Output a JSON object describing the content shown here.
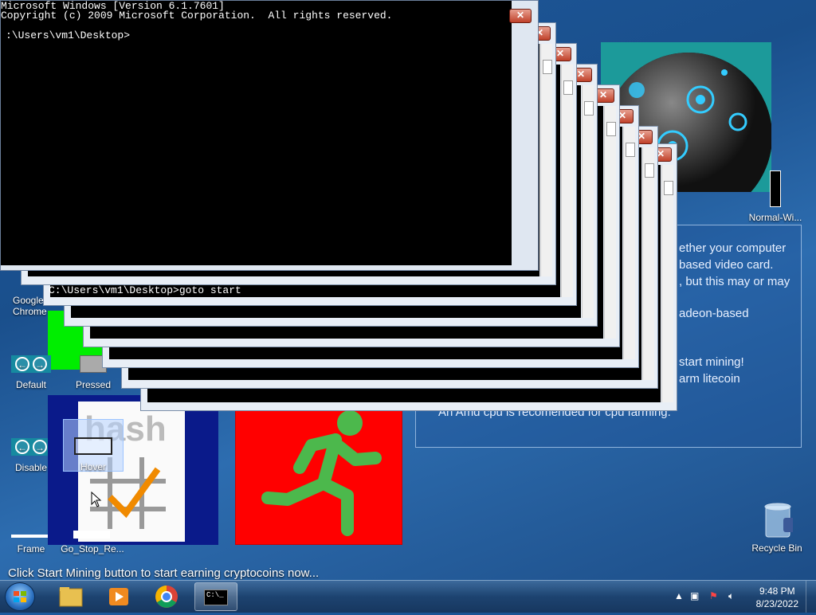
{
  "terminal": {
    "header_line1": "Microsoft Windows [Version 6.1.7601]",
    "header_line2": "Copyright (c) 2009 Microsoft Corporation.  All rights reserved.",
    "prompt": ":\\Users\\vm1\\Desktop>",
    "command_line": "C:\\Users\\vm1\\Desktop>goto start",
    "close_glyph": "✕"
  },
  "desktop_icons": {
    "google_chrome": "Google Chrome",
    "default": "Default",
    "pressed": "Pressed",
    "disable": "Disable",
    "hover": "Hover",
    "frame": "Frame",
    "go_stop": "Go_Stop_Re...",
    "normal_wi": "Normal-Wi...",
    "recycle_bin": "Recycle Bin"
  },
  "info_panel": {
    "line1": "ether your computer",
    "line2": "based video card.",
    "line3": ", but this may or may",
    "line4": "adeon-based",
    "line5": "start mining!",
    "line6": "arm litecoin",
    "line7": "An Amd cpu is recomended for cpu farming."
  },
  "hash_icon_text": "hash",
  "status_text": "Click Start Mining button to start earning cryptocoins now...",
  "taskbar": {
    "time": "9:48 PM",
    "date": "8/23/2022",
    "cmd_icon_label": "C:\\_"
  },
  "colors": {
    "desktop_blue": "#1e5a9e",
    "go_stop_red": "#ff0000",
    "runner_green": "#4cb84c",
    "teal_panel": "#1c9a9a"
  }
}
